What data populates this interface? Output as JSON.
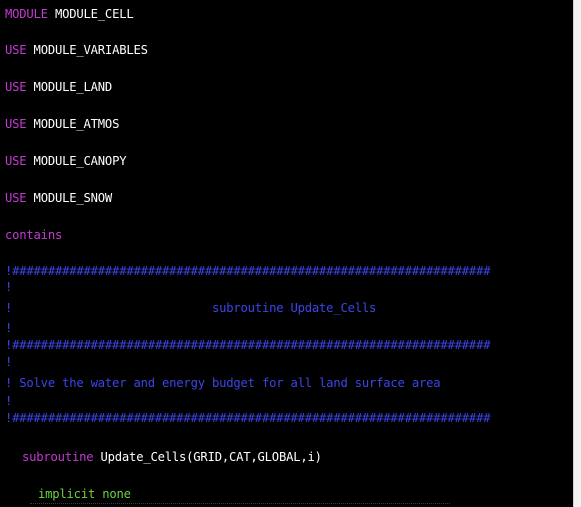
{
  "code_lines": [
    {
      "kw": "MODULE",
      "text": " MODULE_CELL"
    },
    {
      "kw": "USE",
      "text": " MODULE_VARIABLES"
    },
    {
      "kw": "USE",
      "text": " MODULE_LAND"
    },
    {
      "kw": "USE",
      "text": " MODULE_ATMOS"
    },
    {
      "kw": "USE",
      "text": " MODULE_CANOPY"
    },
    {
      "kw": "USE",
      "text": " MODULE_SNOW"
    },
    {
      "kw": "contains",
      "text": ""
    }
  ],
  "comments": {
    "hash_line": "!###################################################################",
    "bang": "!",
    "banner": "!                            subroutine Update_Cells",
    "description": "! Solve the water and energy budget for all land surface area"
  },
  "subroutine_line": {
    "kw": "subroutine",
    "text": " Update_Cells(GRID,CAT,GLOBAL,i)"
  },
  "implicit_line": "implicit none",
  "colors": {
    "background": "#000000",
    "keyword": "#c23bd1",
    "comment": "#3c45e8",
    "green": "#6ed13d",
    "text": "#ffffff"
  }
}
